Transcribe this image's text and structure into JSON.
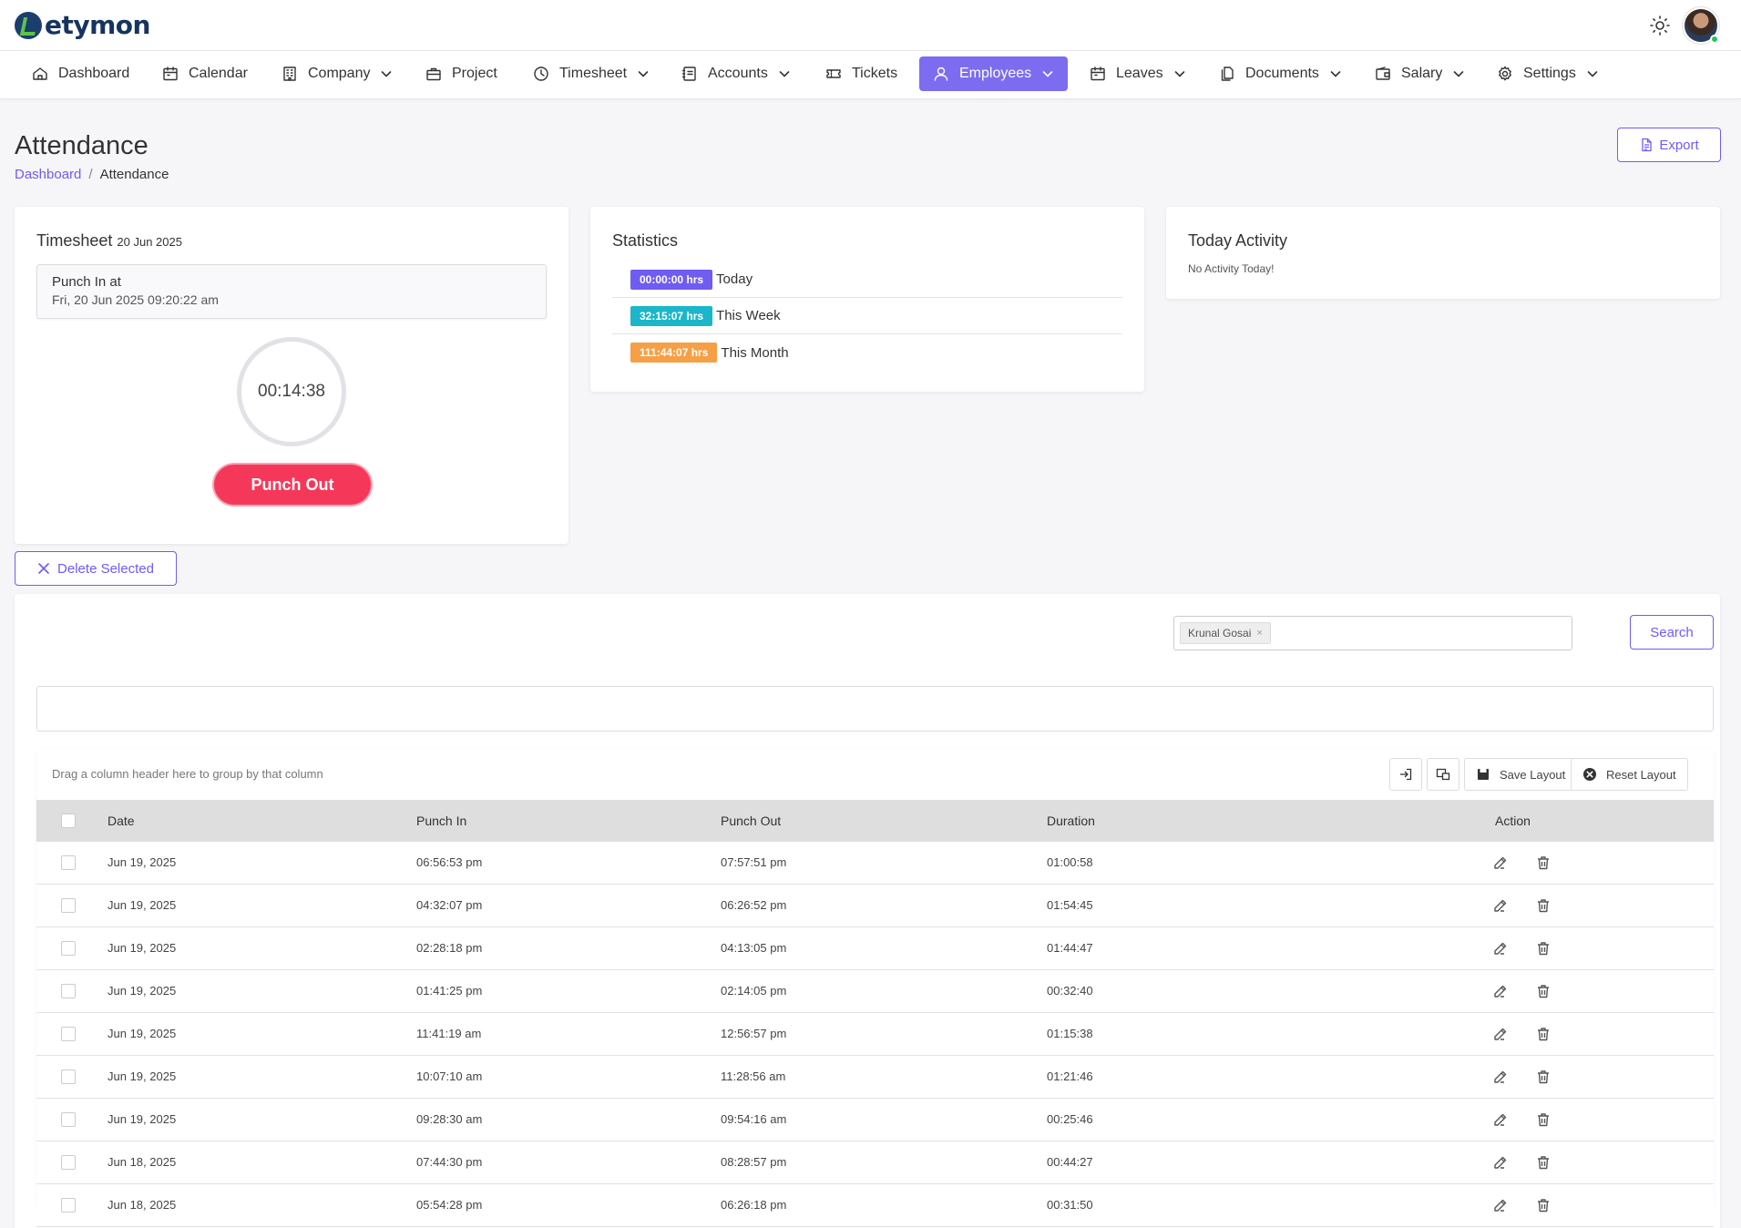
{
  "app": {
    "brand": "etymon"
  },
  "nav": [
    {
      "label": "Dashboard",
      "icon": "home-icon",
      "dropdown": false
    },
    {
      "label": "Calendar",
      "icon": "calendar-icon",
      "dropdown": false
    },
    {
      "label": "Company",
      "icon": "building-icon",
      "dropdown": true
    },
    {
      "label": "Project",
      "icon": "briefcase-icon",
      "dropdown": false
    },
    {
      "label": "Timesheet",
      "icon": "clock-icon",
      "dropdown": true
    },
    {
      "label": "Accounts",
      "icon": "ledger-icon",
      "dropdown": true
    },
    {
      "label": "Tickets",
      "icon": "ticket-icon",
      "dropdown": false
    },
    {
      "label": "Employees",
      "icon": "user-icon",
      "dropdown": true,
      "active": true
    },
    {
      "label": "Leaves",
      "icon": "calendar-icon",
      "dropdown": true
    },
    {
      "label": "Documents",
      "icon": "documents-icon",
      "dropdown": true
    },
    {
      "label": "Salary",
      "icon": "wallet-icon",
      "dropdown": true
    },
    {
      "label": "Settings",
      "icon": "gear-icon",
      "dropdown": true
    }
  ],
  "page": {
    "title": "Attendance",
    "breadcrumb": {
      "root": "Dashboard",
      "separator": "/",
      "current": "Attendance"
    },
    "export_label": "Export",
    "delete_selected_label": "Delete Selected"
  },
  "timesheet": {
    "title": "Timesheet",
    "date": "20 Jun 2025",
    "punch_in_label": "Punch In at",
    "punch_in_value": "Fri, 20 Jun 2025 09:20:22 am",
    "timer": "00:14:38",
    "punch_out_label": "Punch Out"
  },
  "statistics": {
    "title": "Statistics",
    "rows": [
      {
        "value": "00:00:00 hrs",
        "label": "Today",
        "color": "#6f5cf0"
      },
      {
        "value": "32:15:07 hrs",
        "label": "This Week",
        "color": "#1bb6c9"
      },
      {
        "value": "111:44:07 hrs",
        "label": "This Month",
        "color": "#f5a046"
      }
    ]
  },
  "activity": {
    "title": "Today Activity",
    "empty_text": "No Activity Today!"
  },
  "filter": {
    "chip": "Krunal Gosai",
    "chip_remove": "×",
    "search_label": "Search"
  },
  "grid": {
    "group_hint": "Drag a column header here to group by that column",
    "save_layout": "Save Layout",
    "reset_layout": "Reset Layout",
    "columns": {
      "date": "Date",
      "punch_in": "Punch In",
      "punch_out": "Punch Out",
      "duration": "Duration",
      "action": "Action"
    },
    "rows": [
      {
        "date": "Jun 19, 2025",
        "punch_in": "06:56:53 pm",
        "punch_out": "07:57:51 pm",
        "duration": "01:00:58"
      },
      {
        "date": "Jun 19, 2025",
        "punch_in": "04:32:07 pm",
        "punch_out": "06:26:52 pm",
        "duration": "01:54:45"
      },
      {
        "date": "Jun 19, 2025",
        "punch_in": "02:28:18 pm",
        "punch_out": "04:13:05 pm",
        "duration": "01:44:47"
      },
      {
        "date": "Jun 19, 2025",
        "punch_in": "01:41:25 pm",
        "punch_out": "02:14:05 pm",
        "duration": "00:32:40"
      },
      {
        "date": "Jun 19, 2025",
        "punch_in": "11:41:19 am",
        "punch_out": "12:56:57 pm",
        "duration": "01:15:38"
      },
      {
        "date": "Jun 19, 2025",
        "punch_in": "10:07:10 am",
        "punch_out": "11:28:56 am",
        "duration": "01:21:46"
      },
      {
        "date": "Jun 19, 2025",
        "punch_in": "09:28:30 am",
        "punch_out": "09:54:16 am",
        "duration": "00:25:46"
      },
      {
        "date": "Jun 18, 2025",
        "punch_in": "07:44:30 pm",
        "punch_out": "08:28:57 pm",
        "duration": "00:44:27"
      },
      {
        "date": "Jun 18, 2025",
        "punch_in": "05:54:28 pm",
        "punch_out": "06:26:18 pm",
        "duration": "00:31:50"
      }
    ]
  },
  "colors": {
    "accent": "#6f5cf0",
    "nav_active": "#7c6cf0",
    "danger": "#f5385a"
  }
}
